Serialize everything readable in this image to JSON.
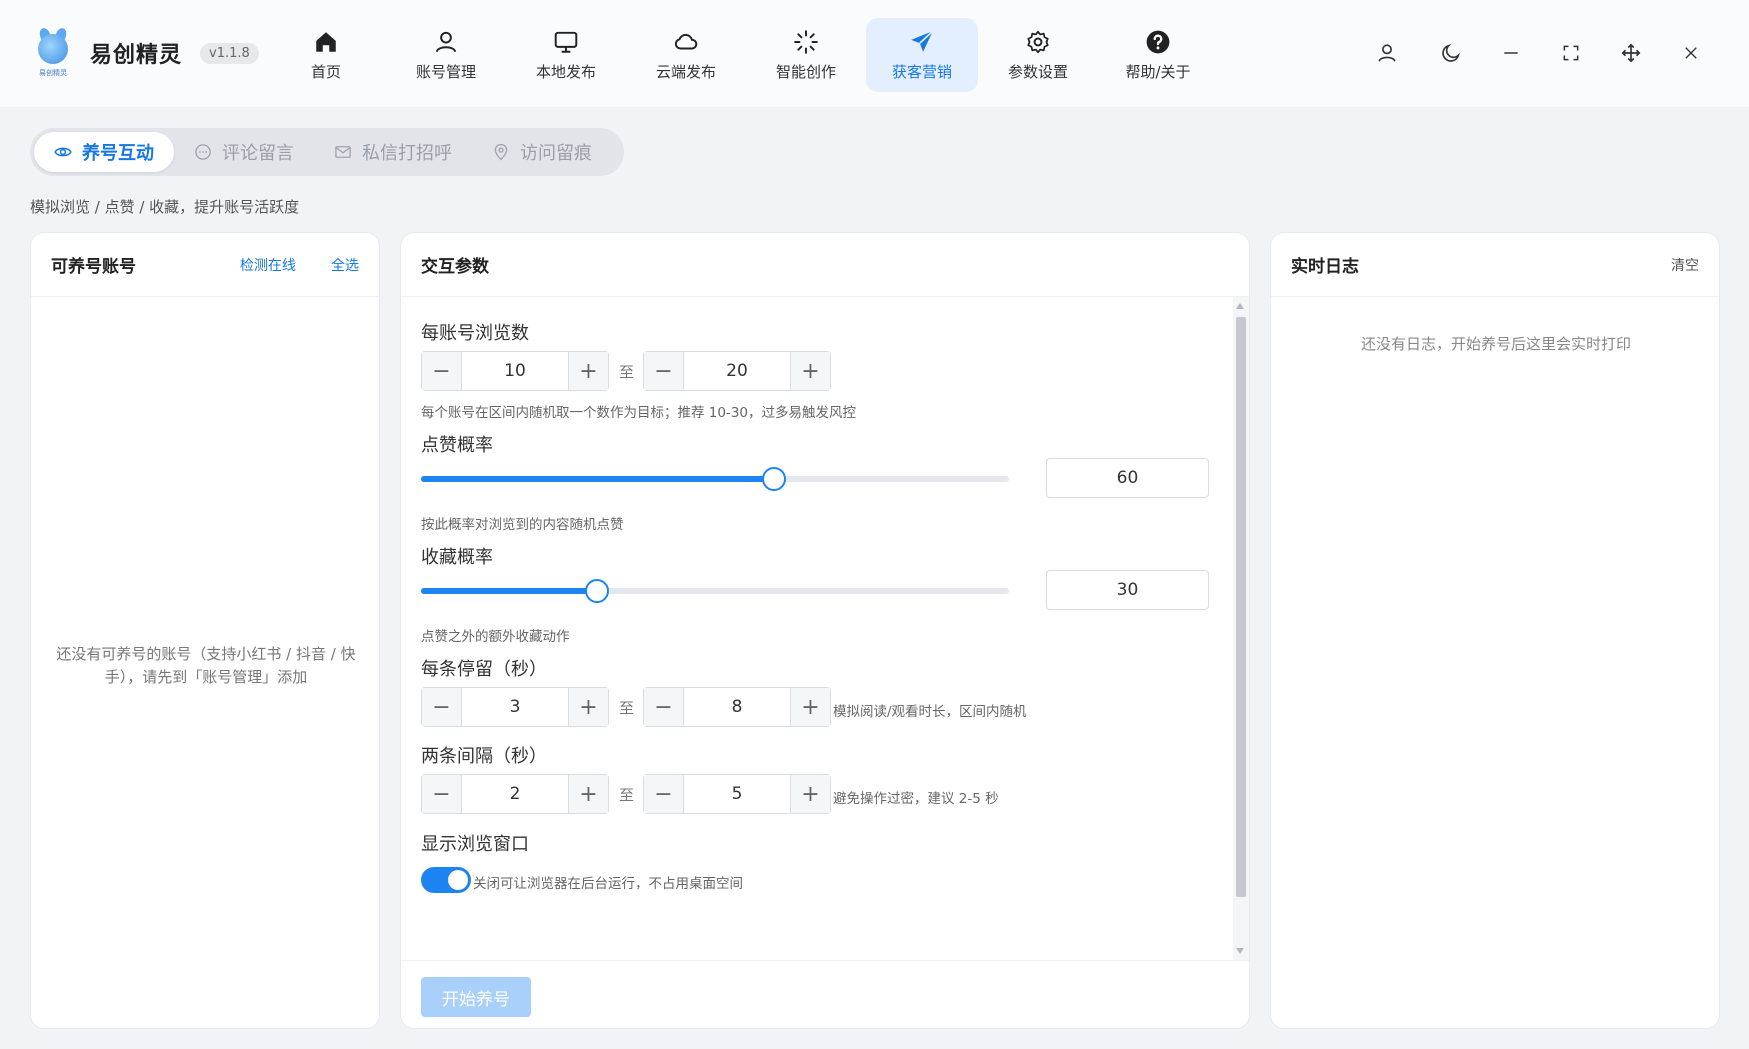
{
  "app": {
    "name": "易创精灵",
    "version": "v1.1.8",
    "logo_caption": "易创精灵"
  },
  "nav": [
    {
      "label": "首页",
      "icon": "home-icon"
    },
    {
      "label": "账号管理",
      "icon": "user-icon"
    },
    {
      "label": "本地发布",
      "icon": "monitor-icon"
    },
    {
      "label": "云端发布",
      "icon": "cloud-icon"
    },
    {
      "label": "智能创作",
      "icon": "sparkle-icon"
    },
    {
      "label": "获客营销",
      "icon": "send-icon",
      "active": true
    },
    {
      "label": "参数设置",
      "icon": "gear-icon"
    },
    {
      "label": "帮助/关于",
      "icon": "help-icon"
    }
  ],
  "window_controls": [
    "profile-icon",
    "moon-icon",
    "minimize-icon",
    "fullscreen-icon",
    "move-icon",
    "close-icon"
  ],
  "tabs": [
    {
      "label": "养号互动",
      "icon": "eye-icon",
      "active": true
    },
    {
      "label": "评论留言",
      "icon": "comment-icon"
    },
    {
      "label": "私信打招呼",
      "icon": "mail-icon"
    },
    {
      "label": "访问留痕",
      "icon": "location-icon"
    }
  ],
  "subtitle": "模拟浏览 / 点赞 / 收藏，提升账号活跃度",
  "accounts_panel": {
    "title": "可养号账号",
    "check_online": "检测在线",
    "select_all": "全选",
    "empty_text": "还没有可养号的账号（支持小红书 / 抖音 / 快手），请先到「账号管理」添加"
  },
  "params_panel": {
    "title": "交互参数",
    "browse_count": {
      "label": "每账号浏览数",
      "min": "10",
      "max": "20",
      "to": "至",
      "hint": "每个账号在区间内随机取一个数作为目标；推荐 10-30，过多易触发风控"
    },
    "like_rate": {
      "label": "点赞概率",
      "value": "60",
      "percent": 60,
      "hint": "按此概率对浏览到的内容随机点赞"
    },
    "fav_rate": {
      "label": "收藏概率",
      "value": "30",
      "percent": 30,
      "hint": "点赞之外的额外收藏动作"
    },
    "stay_seconds": {
      "label": "每条停留（秒）",
      "min": "3",
      "max": "8",
      "to": "至",
      "hint": "模拟阅读/观看时长，区间内随机"
    },
    "interval_seconds": {
      "label": "两条间隔（秒）",
      "min": "2",
      "max": "5",
      "to": "至",
      "hint": "避免操作过密，建议 2-5 秒"
    },
    "show_window": {
      "label": "显示浏览窗口",
      "enabled": true,
      "hint": "关闭可让浏览器在后台运行，不占用桌面空间"
    },
    "start_button": "开始养号",
    "minus": "−",
    "plus": "+"
  },
  "log_panel": {
    "title": "实时日志",
    "clear": "清空",
    "empty_text": "还没有日志，开始养号后这里会实时打印"
  },
  "colors": {
    "accent": "#1677e6",
    "slider": "#1d83f0",
    "start_disabled": "#a9d0fa"
  }
}
